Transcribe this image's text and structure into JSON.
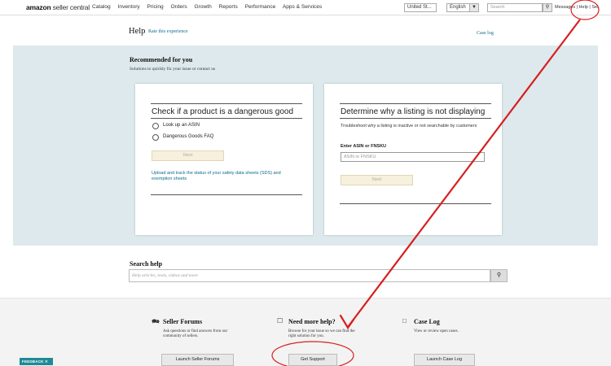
{
  "topbar": {
    "logo_bold": "amazon",
    "logo_rest": " seller central",
    "nav": [
      "Catalog",
      "Inventory",
      "Pricing",
      "Orders",
      "Growth",
      "Reports",
      "Performance",
      "Apps & Services"
    ],
    "marketplace": "United St...",
    "language": "English",
    "search_placeholder": "Search",
    "links": "Messages | Help | Sel"
  },
  "help": {
    "title": "Help",
    "rate": "Rate this experience",
    "case_log": "Case log"
  },
  "recommended": {
    "title": "Recommended for you",
    "subtitle": "Solutions to quickly fix your issue or contact us"
  },
  "card1": {
    "title": "Check if a product is a dangerous good",
    "option1": "Look up an ASIN",
    "option2": "Dangerous Goods FAQ",
    "next": "Next",
    "link": "Upload and track the status of your safety data sheets (SDS) and exemption sheets"
  },
  "card2": {
    "title": "Determine why a listing is not displaying",
    "desc": "Troubleshoot why a listing is inactive or not searchable by customers",
    "label": "Enter ASIN or FNSKU",
    "placeholder": "ASIN or FNSKU",
    "next": "Next"
  },
  "search_help": {
    "title": "Search help",
    "placeholder": "Help articles, tools, videos and more"
  },
  "bottom": {
    "forums_title": "Seller Forums",
    "forums_desc": "Ask questions or find answers from our community of sellers.",
    "forums_btn": "Launch Seller Forums",
    "support_title": "Need more help?",
    "support_desc": "Browse for your issue so we can find the right solution for you.",
    "support_btn": "Get Support",
    "caselog_title": "Case Log",
    "caselog_desc": "View or review open cases.",
    "caselog_btn": "Launch Case Log"
  },
  "feedback": "FEEDBACK ✕",
  "colors": {
    "band": "#dde9ec",
    "link": "#0a6c8c",
    "annotation": "#d62020",
    "feedback": "#1e8a96"
  }
}
